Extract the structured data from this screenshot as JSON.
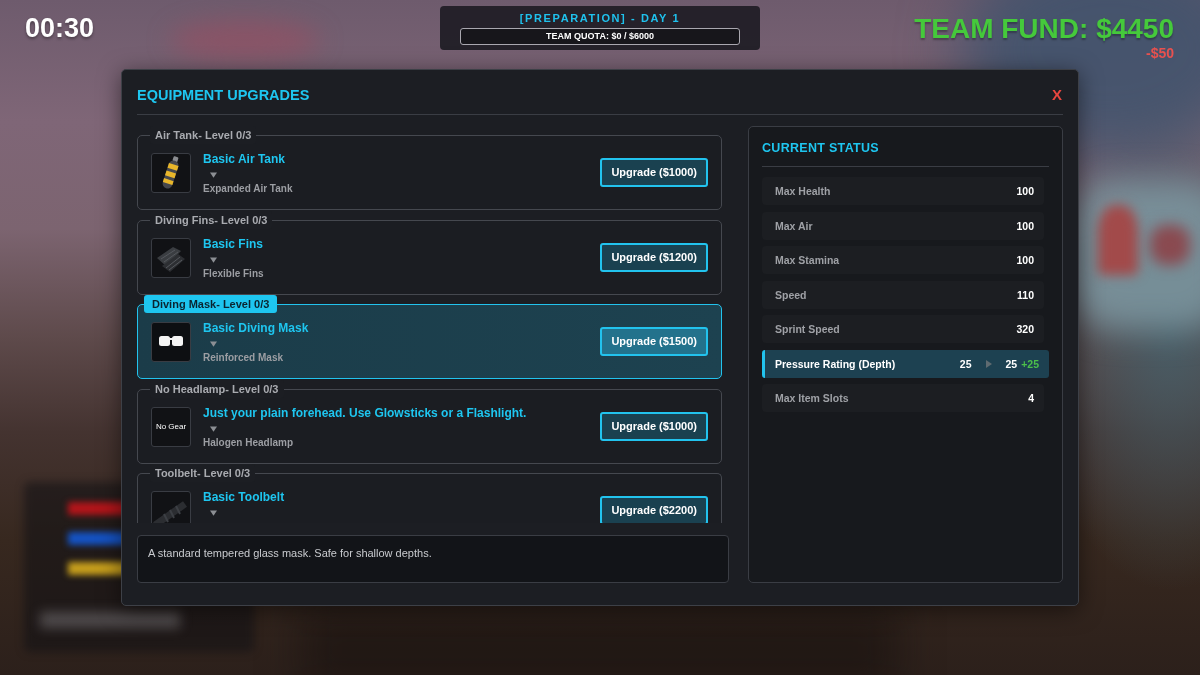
{
  "hud": {
    "timer": "00:30",
    "phase": "[PREPARATION] - DAY 1",
    "quota": "TEAM QUOTA: $0 / $6000",
    "fund": "TEAM FUND: $4450",
    "fund_change": "-$50"
  },
  "dialog": {
    "title": "EQUIPMENT UPGRADES",
    "close": "X"
  },
  "upgrades": [
    {
      "slot": "Air Tank- Level 0/3",
      "name": "Basic Air Tank",
      "next_tier": "Expanded Air Tank",
      "button": "Upgrade ($1000)",
      "selected": false
    },
    {
      "slot": "Diving Fins- Level 0/3",
      "name": "Basic Fins",
      "next_tier": "Flexible Fins",
      "button": "Upgrade ($1200)",
      "selected": false
    },
    {
      "slot": "Diving Mask- Level 0/3",
      "name": "Basic Diving Mask",
      "next_tier": "Reinforced Mask",
      "button": "Upgrade ($1500)",
      "selected": true
    },
    {
      "slot": "No Headlamp- Level 0/3",
      "thumb_text": "No Gear",
      "name": "Just your plain forehead. Use Glowsticks or a Flashlight.",
      "next_tier": "Halogen Headlamp",
      "button": "Upgrade ($1000)",
      "selected": false
    },
    {
      "slot": "Toolbelt- Level 0/3",
      "name": "Basic Toolbelt",
      "button": "Upgrade ($2200)",
      "selected": false
    }
  ],
  "description": "A standard tempered glass mask. Safe for shallow depths.",
  "status": {
    "title": "CURRENT STATUS",
    "stats": [
      {
        "label": "Max Health",
        "value": "100",
        "highlighted": false
      },
      {
        "label": "Max Air",
        "value": "100",
        "highlighted": false
      },
      {
        "label": "Max Stamina",
        "value": "100",
        "highlighted": false
      },
      {
        "label": "Speed",
        "value": "110",
        "highlighted": false
      },
      {
        "label": "Sprint Speed",
        "value": "320",
        "highlighted": false
      },
      {
        "label": "Pressure Rating (Depth)",
        "value": "25",
        "new_value": "25",
        "change": "+25",
        "highlighted": true
      },
      {
        "label": "Max Item Slots",
        "value": "4",
        "highlighted": false
      }
    ]
  }
}
